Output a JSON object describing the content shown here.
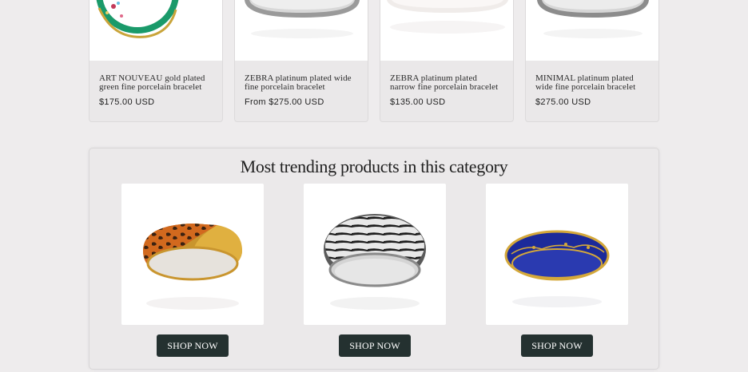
{
  "products": [
    {
      "title": "ART NOUVEAU gold plated green fine porcelain bracelet",
      "price": "$175.00 USD",
      "icon": "green-gold-bracelet-image"
    },
    {
      "title": "ZEBRA platinum plated wide fine porcelain bracelet",
      "price": "From $275.00 USD",
      "icon": "silver-bracelet-image"
    },
    {
      "title": "ZEBRA platinum plated narrow fine porcelain bracelet",
      "price": "$135.00 USD",
      "icon": "white-bracelet-image"
    },
    {
      "title": "MINIMAL platinum plated wide fine porcelain bracelet",
      "price": "$275.00 USD",
      "icon": "silver-bracelet-image"
    }
  ],
  "trending": {
    "title": "Most trending products in this category",
    "items": [
      {
        "button": "SHOP NOW",
        "icon": "leopard-gold-bracelet-image"
      },
      {
        "button": "SHOP NOW",
        "icon": "zebra-platinum-bracelet-image"
      },
      {
        "button": "SHOP NOW",
        "icon": "blue-gold-bracelet-image"
      }
    ]
  },
  "colors": {
    "page_background": "#eeeced",
    "button_background": "#243130",
    "button_text": "#ffffff"
  }
}
